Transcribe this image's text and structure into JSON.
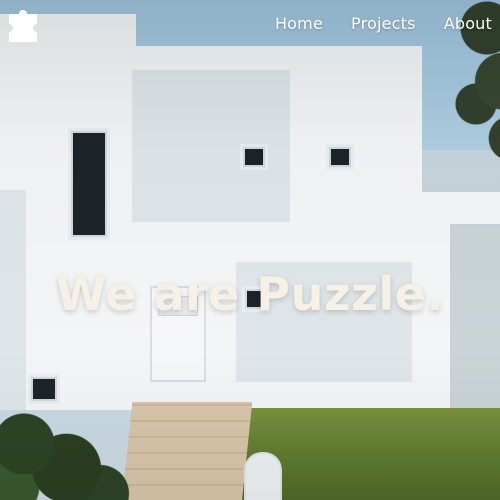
{
  "nav": {
    "items": [
      {
        "label": "Home"
      },
      {
        "label": "Projects"
      },
      {
        "label": "About"
      }
    ],
    "logo_icon": "puzzle-piece-icon"
  },
  "hero": {
    "headline": "We are Puzzle."
  }
}
